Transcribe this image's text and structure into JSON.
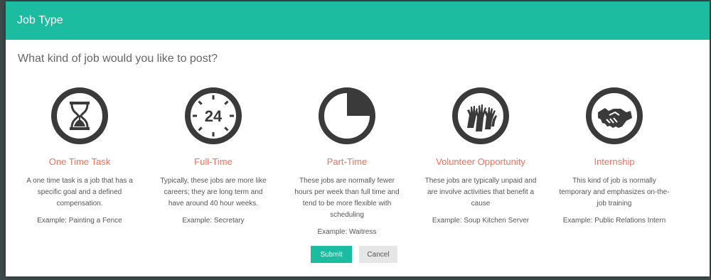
{
  "modal": {
    "title": "Job Type",
    "question": "What kind of job would you like to post?"
  },
  "colors": {
    "accent": "#1cbca1",
    "option_title": "#f4705a",
    "icon": "#3a3a3a"
  },
  "options": [
    {
      "icon": "hourglass-icon",
      "title": "One Time Task",
      "description": "A one time task is a job that has a specific goal and a defined compensation.",
      "example": "Example:  Painting a Fence"
    },
    {
      "icon": "clock-24-icon",
      "title": "Full-Time",
      "description": "Typically, these jobs are more like careers; they are long term and have around 40 hour weeks.",
      "example": "Example:  Secretary"
    },
    {
      "icon": "pie-clock-icon",
      "title": "Part-Time",
      "description": "These jobs are normally fewer hours per week than full time and tend to be more flexible with scheduling",
      "example": "Example:  Waitress"
    },
    {
      "icon": "raised-hands-icon",
      "title": "Volunteer Opportunity",
      "description": "These jobs are typically unpaid and are involve activities that benefit a cause",
      "example": "Example:  Soup Kitchen Server"
    },
    {
      "icon": "handshake-icon",
      "title": "Internship",
      "description": "This kind of job is normally temporary and emphasizes on-the-job training",
      "example": "Example:  Public Relations Intern"
    }
  ],
  "buttons": {
    "submit": "Submit",
    "cancel": "Cancel"
  },
  "icon_text": {
    "clock_number": "24"
  }
}
